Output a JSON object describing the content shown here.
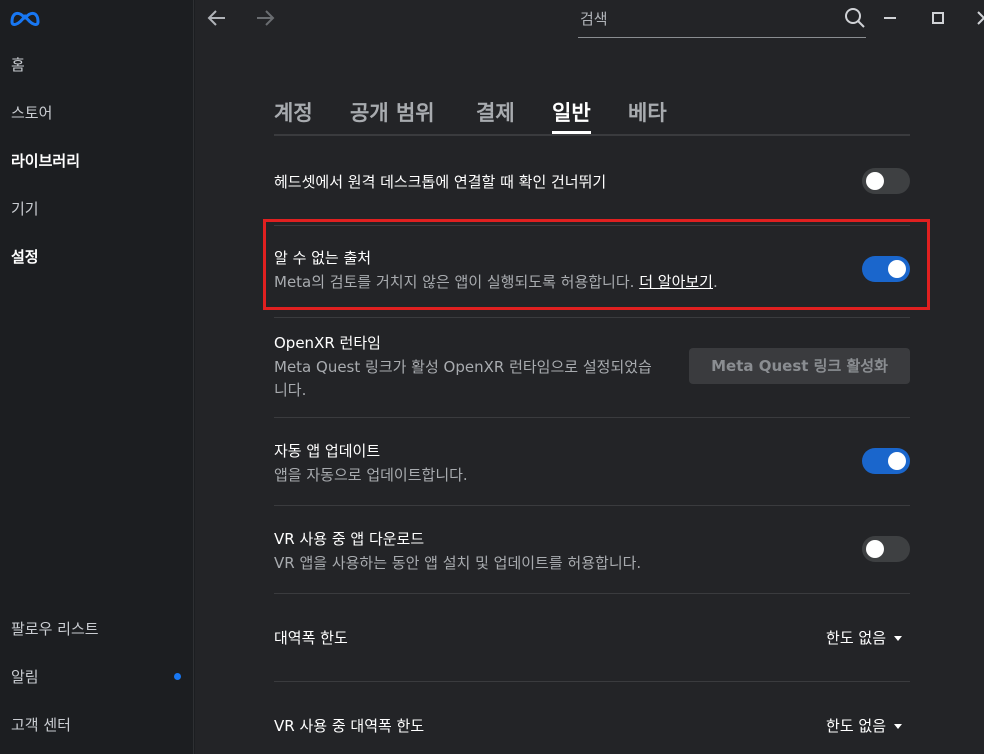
{
  "sidebar": {
    "logo_icon": "meta-logo-icon",
    "items": [
      {
        "label": "홈"
      },
      {
        "label": "스토어"
      },
      {
        "label": "라이브러리"
      },
      {
        "label": "기기"
      },
      {
        "label": "설정"
      }
    ],
    "bottom_items": [
      {
        "label": "팔로우 리스트"
      },
      {
        "label": "알림"
      },
      {
        "label": "고객 센터"
      }
    ],
    "notification_color": "#1877f2"
  },
  "topbar": {
    "search": {
      "placeholder": "검색",
      "value": ""
    },
    "icons": [
      "back-arrow-icon",
      "forward-arrow-icon",
      "search-icon",
      "minimize-icon",
      "maximize-icon",
      "close-icon"
    ]
  },
  "tabs": [
    {
      "label": "계정"
    },
    {
      "label": "공개 범위"
    },
    {
      "label": "결제"
    },
    {
      "label": "일반"
    },
    {
      "label": "베타"
    }
  ],
  "active_tab": "일반",
  "settings": {
    "skip_remote_desktop": {
      "title": "헤드셋에서 원격 데스크톱에 연결할 때 확인 건너뛰기",
      "enabled": false
    },
    "unknown_sources": {
      "title": "알 수 없는 출처",
      "desc_prefix": "Meta의 검토를 거치지 않은 앱이 실행되도록 허용합니다. ",
      "link": "더 알아보기",
      "desc_suffix": ".",
      "enabled": true
    },
    "openxr": {
      "title": "OpenXR 런타임",
      "desc_line1": "Meta Quest 링크가 활성 OpenXR 런타임으로 설정되었습",
      "desc_line2": "니다.",
      "button": "Meta Quest 링크 활성화"
    },
    "auto_update": {
      "title": "자동 앱 업데이트",
      "desc": "앱을 자동으로 업데이트합니다.",
      "enabled": true
    },
    "vr_download": {
      "title": "VR 사용 중 앱 다운로드",
      "desc": "VR 앱을 사용하는 동안 앱 설치 및 업데이트를 허용합니다.",
      "enabled": false
    },
    "bandwidth": {
      "title": "대역폭 한도",
      "value": "한도 없음"
    },
    "vr_bandwidth": {
      "title": "VR 사용 중 대역폭 한도",
      "value": "한도 없음"
    }
  },
  "colors": {
    "toggle_on": "#1a66cc",
    "toggle_off": "#3e4042",
    "highlight": "#e02020"
  }
}
